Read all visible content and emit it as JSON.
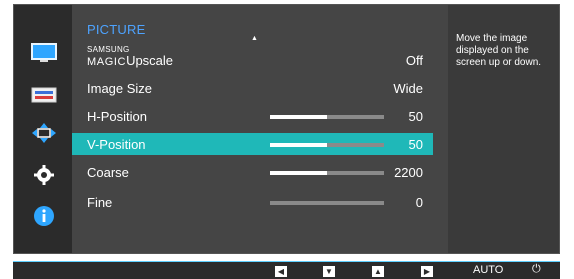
{
  "menu": {
    "title": "PICTURE",
    "up_arrow": "▲",
    "items": [
      {
        "label_small": "SAMSUNG",
        "label_big": "MAGIC",
        "label": "Upscale",
        "value": "Off"
      },
      {
        "label": "Image Size",
        "value": "Wide"
      },
      {
        "label": "H-Position",
        "value": "50",
        "level": 0.5
      },
      {
        "label": "V-Position",
        "value": "50",
        "level": 0.5
      },
      {
        "label": "Coarse",
        "value": "2200",
        "level": 0.5
      },
      {
        "label": "Fine",
        "value": "0",
        "level": 0.0
      }
    ]
  },
  "help": {
    "text": "Move the image displayed on the screen up or down."
  },
  "bottom": {
    "left": "◀",
    "down": "▼",
    "up": "▲",
    "right": "▶",
    "auto": "AUTO",
    "power": "⏻"
  },
  "colors": {
    "accent": "#1fb8b8",
    "title": "#4da3ff"
  }
}
